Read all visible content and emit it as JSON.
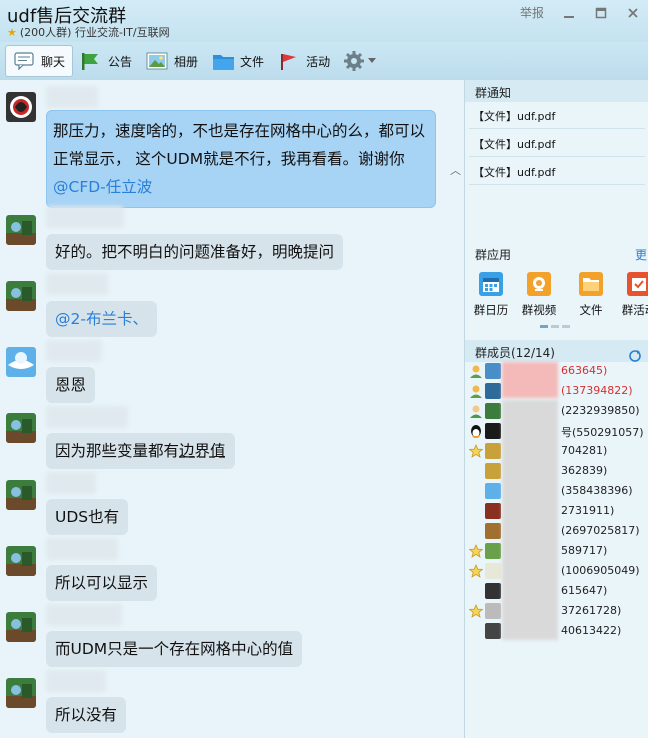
{
  "window": {
    "title": "udf售后交流群",
    "subtitle": "(200人群) 行业交流-IT/互联网",
    "report_label": "举报"
  },
  "toolbar": {
    "items": [
      {
        "label": "聊天",
        "icon": "chat-icon",
        "active": true
      },
      {
        "label": "公告",
        "icon": "flag-icon"
      },
      {
        "label": "相册",
        "icon": "photo-icon"
      },
      {
        "label": "文件",
        "icon": "folder-icon"
      },
      {
        "label": "活动",
        "icon": "activity-flag-icon"
      }
    ]
  },
  "messages": [
    {
      "text": "那压力，速度啥的，不也是存在网格中心的么，都可以正常显示， 这个UDM就是不行，我再看看。谢谢你",
      "mention": "@CFD-任立波",
      "highlight": true
    },
    {
      "text": "好的。把不明白的问题准备好，明晚提问"
    },
    {
      "mention": "@2-布兰卡、"
    },
    {
      "text": "恩恩"
    },
    {
      "text_pre": "因为那些变量都有",
      "text_mark": "边界值"
    },
    {
      "text": "UDS也有"
    },
    {
      "text": "所以可以显示"
    },
    {
      "text": "而UDM只是一个存在网格中心的值"
    },
    {
      "text": "所以没有"
    }
  ],
  "side": {
    "notice_header": "群通知",
    "notices": [
      "【文件】udf.pdf",
      "【文件】udf.pdf",
      "【文件】udf.pdf"
    ],
    "apps_header": "群应用",
    "apps_more": "更",
    "apps": [
      {
        "label": "群日历",
        "icon": "calendar-icon",
        "color": "#3aa0e6"
      },
      {
        "label": "群视频",
        "icon": "video-icon",
        "color": "#f2a12a"
      },
      {
        "label": "文件",
        "icon": "folder-icon",
        "color": "#f2a12a"
      },
      {
        "label": "群活动",
        "icon": "activity-icon",
        "color": "#e8532f"
      }
    ],
    "members_header": "群成员(12/14)",
    "members": [
      {
        "id": "663645)",
        "red": true,
        "role": "owner"
      },
      {
        "id": "(137394822)",
        "red": true,
        "role": "owner"
      },
      {
        "id": "(2232939850)",
        "role": "admin"
      },
      {
        "id": "号(550291057)",
        "role": "qq"
      },
      {
        "id": "704281)",
        "role": "star"
      },
      {
        "id": "362839)"
      },
      {
        "id": "(358438396)"
      },
      {
        "id": "2731911)"
      },
      {
        "id": "(2697025817)"
      },
      {
        "id": "589717)",
        "role": "star"
      },
      {
        "id": "(1006905049)",
        "role": "star"
      },
      {
        "id": "615647)"
      },
      {
        "id": "37261728)",
        "role": "star"
      },
      {
        "id": "40613422)"
      }
    ]
  }
}
